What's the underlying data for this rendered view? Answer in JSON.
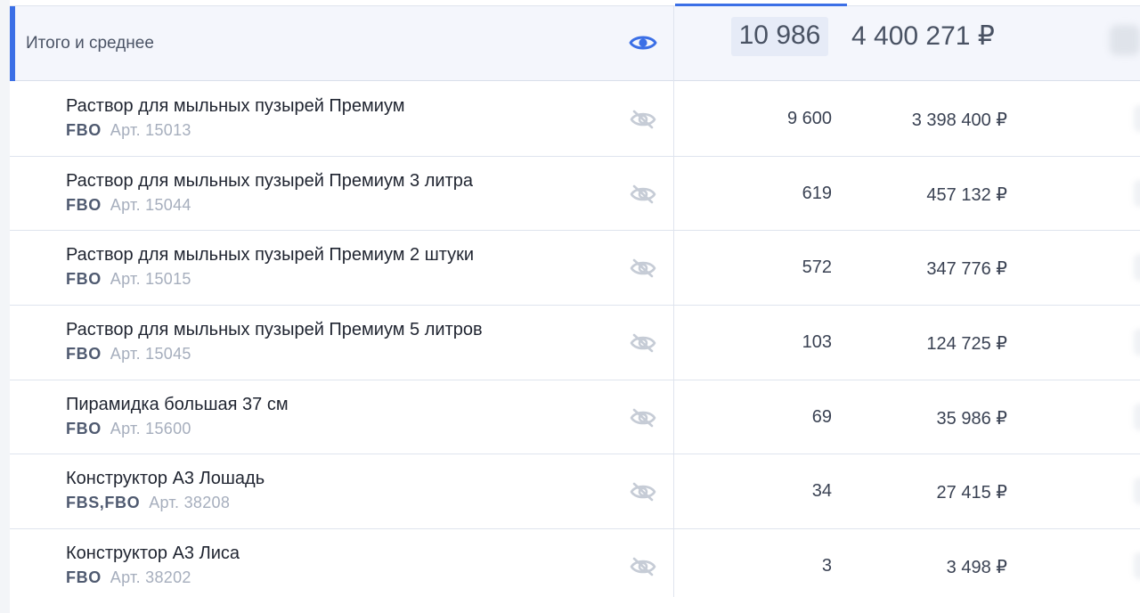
{
  "summary": {
    "label": "Итого и среднее",
    "total_qty": "10 986",
    "total_revenue": "4 400 271 ₽",
    "visibility_icon": "eye-icon"
  },
  "products": [
    {
      "name": "Раствор для мыльных пузырей Премиум",
      "scheme": "FBO",
      "article": "Арт. 15013",
      "qty": "9 600",
      "revenue": "3 398 400 ₽",
      "visibility_icon": "eye-off-icon"
    },
    {
      "name": "Раствор для мыльных пузырей Премиум 3 литра",
      "scheme": "FBO",
      "article": "Арт. 15044",
      "qty": "619",
      "revenue": "457 132 ₽",
      "visibility_icon": "eye-off-icon"
    },
    {
      "name": "Раствор для мыльных пузырей Премиум 2 штуки",
      "scheme": "FBO",
      "article": "Арт. 15015",
      "qty": "572",
      "revenue": "347 776 ₽",
      "visibility_icon": "eye-off-icon"
    },
    {
      "name": "Раствор для мыльных пузырей Премиум 5 литров",
      "scheme": "FBO",
      "article": "Арт. 15045",
      "qty": "103",
      "revenue": "124 725 ₽",
      "visibility_icon": "eye-off-icon"
    },
    {
      "name": "Пирамидка большая 37 см",
      "scheme": "FBO",
      "article": "Арт. 15600",
      "qty": "69",
      "revenue": "35 986 ₽",
      "visibility_icon": "eye-off-icon"
    },
    {
      "name": "Конструктор А3 Лошадь",
      "scheme": "FBS,FBO",
      "article": "Арт. 38208",
      "qty": "34",
      "revenue": "27 415 ₽",
      "visibility_icon": "eye-off-icon"
    },
    {
      "name": "Конструктор А3 Лиса",
      "scheme": "FBO",
      "article": "Арт. 38202",
      "qty": "3",
      "revenue": "3 498 ₽",
      "visibility_icon": "eye-off-icon"
    }
  ],
  "colors": {
    "accent": "#3b6fe6",
    "summary_bg": "#f4f6fc",
    "eye_off": "#c6ccd6"
  }
}
